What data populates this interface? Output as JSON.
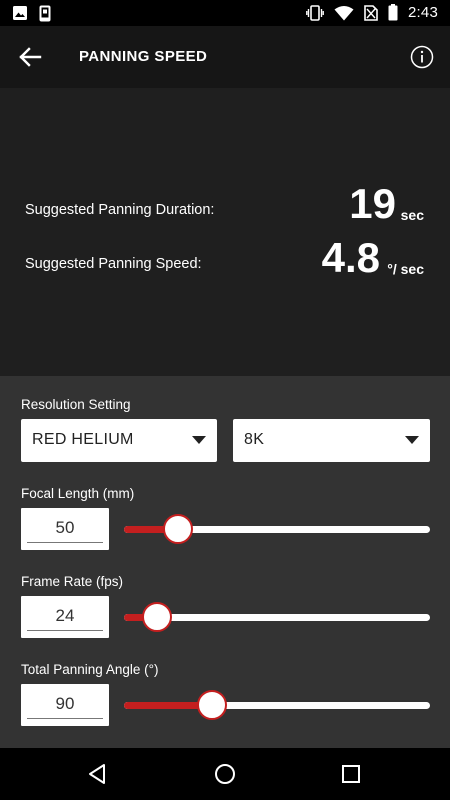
{
  "status_bar": {
    "time": "2:43",
    "left_icons": [
      "image-icon",
      "phone-icon"
    ],
    "right_icons": [
      "vibrate-icon",
      "wifi-icon",
      "no-sim-icon",
      "battery-icon"
    ]
  },
  "app_bar": {
    "title": "PANNING SPEED",
    "back_icon": "arrow-back-icon",
    "info_icon": "info-icon"
  },
  "results": {
    "duration_label": "Suggested Panning Duration:",
    "duration_value": "19",
    "duration_unit": "sec",
    "speed_label": "Suggested Panning Speed:",
    "speed_value": "4.8",
    "speed_unit": "°/ sec"
  },
  "resolution": {
    "label": "Resolution Setting",
    "camera": "RED HELIUM",
    "resolution": "8K"
  },
  "focal_length": {
    "label": "Focal Length (mm)",
    "value": "50",
    "slider_fraction": 0.16
  },
  "frame_rate": {
    "label": "Frame Rate (fps)",
    "value": "24",
    "slider_fraction": 0.09
  },
  "panning_angle": {
    "label": "Total Panning Angle (°)",
    "value": "90",
    "slider_fraction": 0.27
  },
  "colors": {
    "accent": "#c41f1f",
    "results_bg": "#1f1f1f",
    "controls_bg": "#333333"
  },
  "nav_bar": {
    "icons": [
      "back-triangle-icon",
      "home-circle-icon",
      "recents-square-icon"
    ]
  }
}
